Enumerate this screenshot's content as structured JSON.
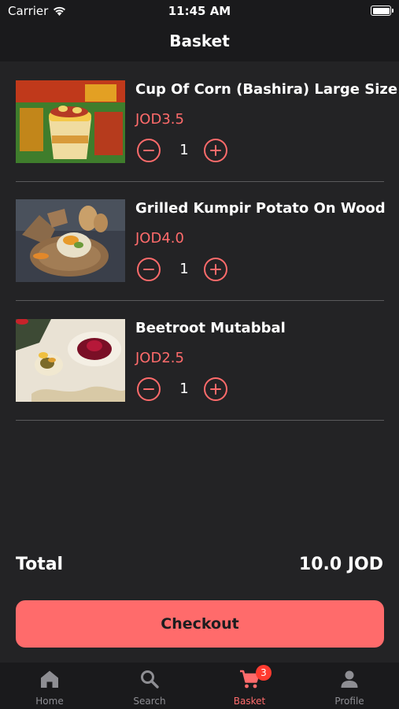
{
  "status_bar": {
    "carrier": "Carrier",
    "time": "11:45 AM"
  },
  "header": {
    "title": "Basket"
  },
  "items": [
    {
      "name": "Cup Of Corn (Bashira) Large Size",
      "price": "JOD3.5",
      "quantity": "1"
    },
    {
      "name": "Grilled Kumpir Potato On Wood",
      "price": "JOD4.0",
      "quantity": "1"
    },
    {
      "name": "Beetroot Mutabbal",
      "price": "JOD2.5",
      "quantity": "1"
    }
  ],
  "summary": {
    "total_label": "Total",
    "total_value": "10.0 JOD"
  },
  "checkout": {
    "label": "Checkout"
  },
  "tabs": [
    {
      "label": "Home",
      "icon": "home-icon"
    },
    {
      "label": "Search",
      "icon": "search-icon"
    },
    {
      "label": "Basket",
      "icon": "cart-icon",
      "badge": "3",
      "active": true
    },
    {
      "label": "Profile",
      "icon": "person-icon"
    }
  ],
  "colors": {
    "accent": "#ff6b6b",
    "background": "#232325",
    "bar_background": "#1a1a1c",
    "badge": "#ff3b30",
    "inactive_tab": "#8e8e93"
  }
}
